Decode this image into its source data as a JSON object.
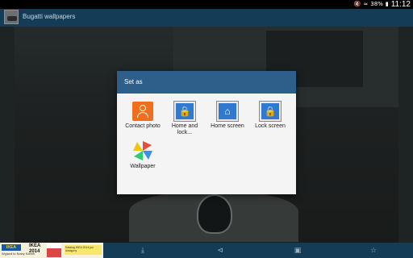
{
  "status_bar": {
    "battery": "38%",
    "time": "11:12",
    "icons": [
      "mute-icon",
      "wifi-icon",
      "battery-icon"
    ]
  },
  "app_bar": {
    "title": "Bugatti wallpapers"
  },
  "dialog": {
    "title": "Set as",
    "options": [
      {
        "label": "Contact photo",
        "icon": "contact-photo-icon"
      },
      {
        "label": "Home and lock...",
        "icon": "home-lock-screen-icon"
      },
      {
        "label": "Home screen",
        "icon": "home-screen-icon"
      },
      {
        "label": "Lock screen",
        "icon": "lock-screen-icon"
      },
      {
        "label": "Wallpaper",
        "icon": "wallpaper-pinwheel-icon"
      }
    ]
  },
  "ad": {
    "brand": "IKEA",
    "slogan": "Wyjazd to Nowy Karnik",
    "catalog": "IKEA",
    "year": "2014",
    "promo": "Katalog IKEA 2014 już dostępny"
  },
  "bottom_actions": [
    "download-icon",
    "share-icon",
    "crop-icon",
    "favorite-star-icon"
  ],
  "colors": {
    "app_bar": "#143c57",
    "dialog_header": "#2e5e8a",
    "dialog_bg": "#f4f4f4",
    "contact_icon": "#f06e1c"
  }
}
